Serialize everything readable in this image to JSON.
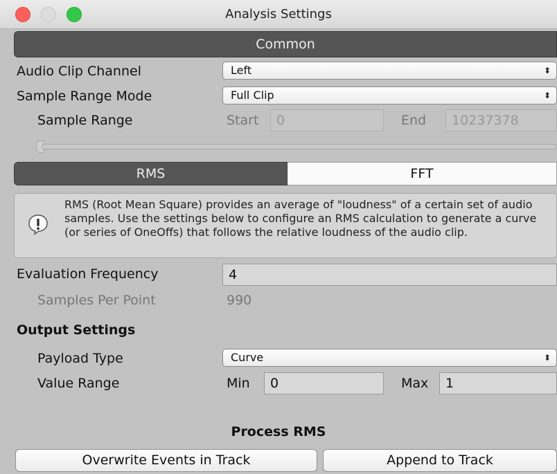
{
  "window": {
    "title": "Analysis Settings"
  },
  "common": {
    "header": "Common",
    "audio_clip_channel": {
      "label": "Audio Clip Channel",
      "value": "Left"
    },
    "sample_range_mode": {
      "label": "Sample Range Mode",
      "value": "Full Clip"
    },
    "sample_range": {
      "label": "Sample Range",
      "start_label": "Start",
      "start_value": "0",
      "end_label": "End",
      "end_value": "10237378"
    }
  },
  "tabs": [
    {
      "label": "RMS",
      "selected": true
    },
    {
      "label": "FFT",
      "selected": false
    }
  ],
  "help": {
    "text": "RMS (Root Mean Square) provides an average of \"loudness\" of a certain set of audio samples.  Use the settings below to configure an RMS calculation to generate a curve (or series of OneOffs) that follows the relative loudness of the audio clip."
  },
  "evaluation": {
    "frequency_label": "Evaluation Frequency",
    "frequency_value": "4",
    "samples_per_point_label": "Samples Per Point",
    "samples_per_point_value": "990"
  },
  "output": {
    "heading": "Output Settings",
    "payload_type": {
      "label": "Payload Type",
      "value": "Curve"
    },
    "value_range": {
      "label": "Value Range",
      "min_label": "Min",
      "min_value": "0",
      "max_label": "Max",
      "max_value": "1"
    }
  },
  "process": {
    "heading": "Process RMS",
    "overwrite_label": "Overwrite Events in Track",
    "append_label": "Append to Track"
  },
  "icons": {
    "dropdown": "updown-arrows-icon",
    "info": "info-exclamation-icon"
  }
}
